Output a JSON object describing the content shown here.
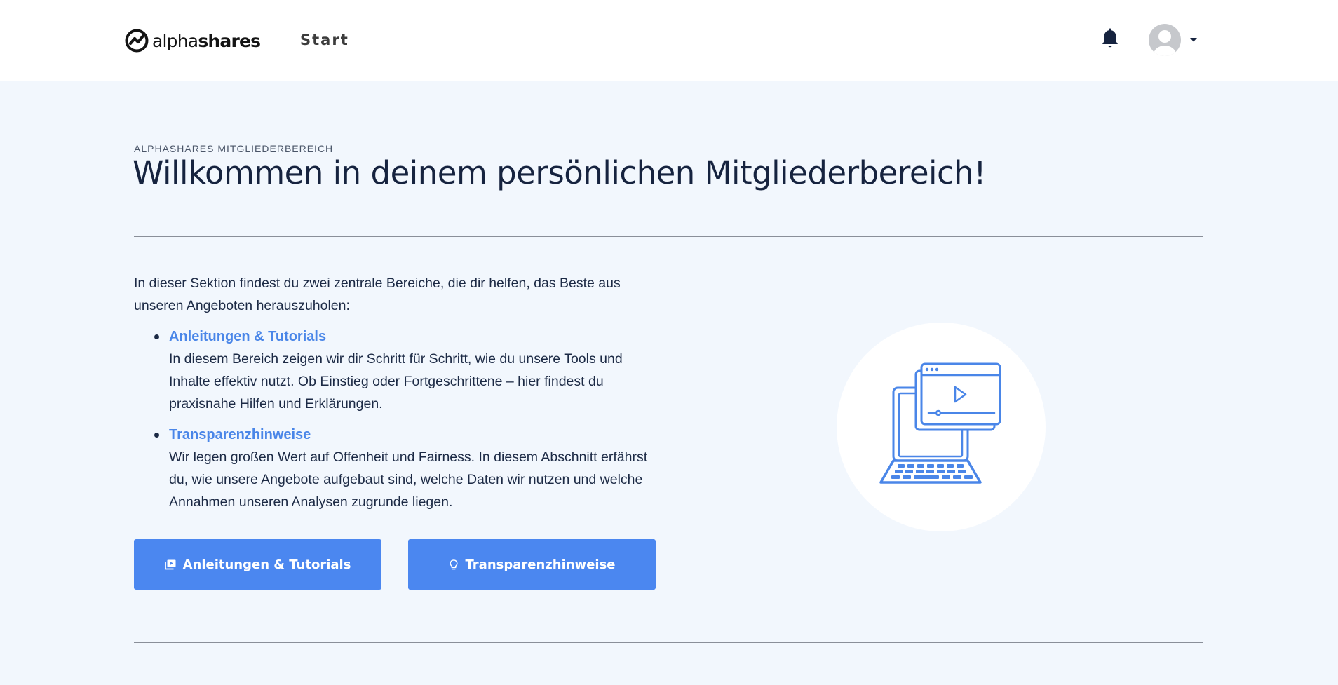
{
  "header": {
    "logo_light": "alpha",
    "logo_bold": "shares",
    "nav_start": "Start",
    "icons": {
      "notifications": "bell-icon",
      "avatar": "user-avatar",
      "menu": "caret-down-icon"
    }
  },
  "main": {
    "eyebrow": "ALPHASHARES MITGLIEDERBEREICH",
    "title": "Willkommen in deinem persönlichen Mitgliederbereich!",
    "intro": "In dieser Sektion findest du zwei zentrale Bereiche, die dir helfen, das Beste aus unseren Angeboten herauszuholen:",
    "sections": [
      {
        "title": "Anleitungen & Tutorials",
        "text": "In diesem Bereich zeigen wir dir Schritt für Schritt, wie du unsere Tools und Inhalte effektiv nutzt. Ob Einstieg oder Fortgeschrittene – hier findest du praxisnahe Hilfen und Erklärungen."
      },
      {
        "title": "Transparenzhinweise",
        "text": "Wir legen großen Wert auf Offenheit und Fairness. In diesem Abschnitt erfährst du, wie unsere Angebote aufgebaut sind, welche Daten wir nutzen und welche Annahmen unseren Analysen zugrunde liegen."
      }
    ],
    "buttons": [
      {
        "label": "Anleitungen & Tutorials",
        "icon": "video-library-icon"
      },
      {
        "label": "Transparenzhinweise",
        "icon": "lightbulb-icon"
      }
    ],
    "illustration": "laptop-video-illustration"
  },
  "colors": {
    "accent": "#4b87f0",
    "link": "#4a86e8",
    "background": "#f2f7fd",
    "heading": "#16233f"
  }
}
